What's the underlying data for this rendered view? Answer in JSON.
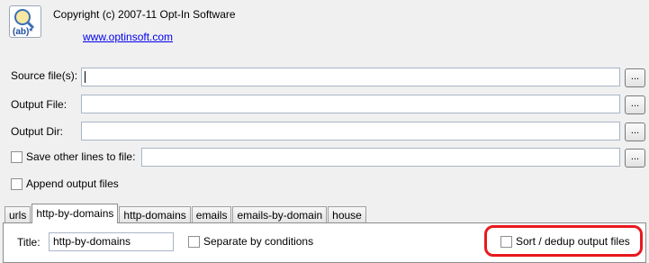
{
  "header": {
    "copyright": "Copyright (c) 2007-11 Opt-In Software",
    "link": "www.optinsoft.com",
    "logo_icon": "regex-search-logo-icon",
    "logo_text": "(ab)*"
  },
  "form": {
    "source_label": "Source file(s):",
    "source_value": "",
    "output_file_label": "Output File:",
    "output_file_value": "",
    "output_dir_label": "Output Dir:",
    "output_dir_value": "",
    "save_other_label": "Save other lines to file:",
    "save_other_checked": false,
    "save_other_value": "",
    "append_label": "Append output files",
    "append_checked": false,
    "browse_label": "..."
  },
  "tabs": [
    {
      "label": "urls",
      "active": false
    },
    {
      "label": "http-by-domains",
      "active": true
    },
    {
      "label": "http-domains",
      "active": false
    },
    {
      "label": "emails",
      "active": false
    },
    {
      "label": "emails-by-domain",
      "active": false
    },
    {
      "label": "house",
      "active": false
    }
  ],
  "panel": {
    "title_label": "Title:",
    "title_value": "http-by-domains",
    "separate_label": "Separate by conditions",
    "separate_checked": false,
    "sort_label": "Sort / dedup output files",
    "sort_checked": false
  },
  "colors": {
    "highlight": "#e8191d",
    "link": "#0000ee"
  }
}
